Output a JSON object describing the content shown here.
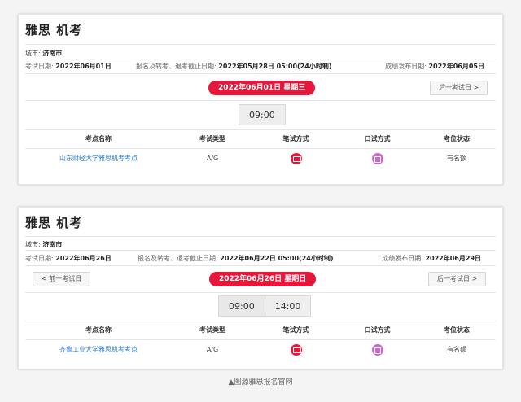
{
  "cards": [
    {
      "title": "雅思 机考",
      "city_label": "城市:",
      "city_value": "济南市",
      "exam_date_label": "考试日期:",
      "exam_date_value": "2022年06月01日",
      "deadline_label": "报名及转考、退考截止日期:",
      "deadline_value": "2022年05月28日 05:00(24小时制)",
      "result_label": "成绩发布日期:",
      "result_value": "2022年06月05日",
      "date_badge": "2022年06月01日 星期三",
      "prev_button": "",
      "next_button": "后一考试日 >",
      "times": [
        "09:00"
      ],
      "headers": [
        "考点名称",
        "考试类型",
        "笔试方式",
        "口试方式",
        "考位状态"
      ],
      "row": {
        "venue": "山东财经大学雅思机考考点",
        "type": "A/G",
        "status": "有名额"
      }
    },
    {
      "title": "雅思 机考",
      "city_label": "城市:",
      "city_value": "济南市",
      "exam_date_label": "考试日期:",
      "exam_date_value": "2022年06月26日",
      "deadline_label": "报名及转考、退考截止日期:",
      "deadline_value": "2022年06月22日 05:00(24小时制)",
      "result_label": "成绩发布日期:",
      "result_value": "2022年06月29日",
      "date_badge": "2022年06月26日 星期日",
      "prev_button": "< 前一考试日",
      "next_button": "后一考试日 >",
      "times": [
        "09:00",
        "14:00"
      ],
      "headers": [
        "考点名称",
        "考试类型",
        "笔试方式",
        "口试方式",
        "考位状态"
      ],
      "row": {
        "venue": "齐鲁工业大学雅思机考考点",
        "type": "A/G",
        "status": "有名额"
      }
    }
  ],
  "caption": "▲图源雅思报名官网",
  "colors": {
    "accent": "#e5173b",
    "link": "#2a7bd3",
    "oral_icon": "#c86bc6"
  },
  "icons": {
    "written": "computer-written-icon",
    "oral": "computer-oral-icon"
  }
}
